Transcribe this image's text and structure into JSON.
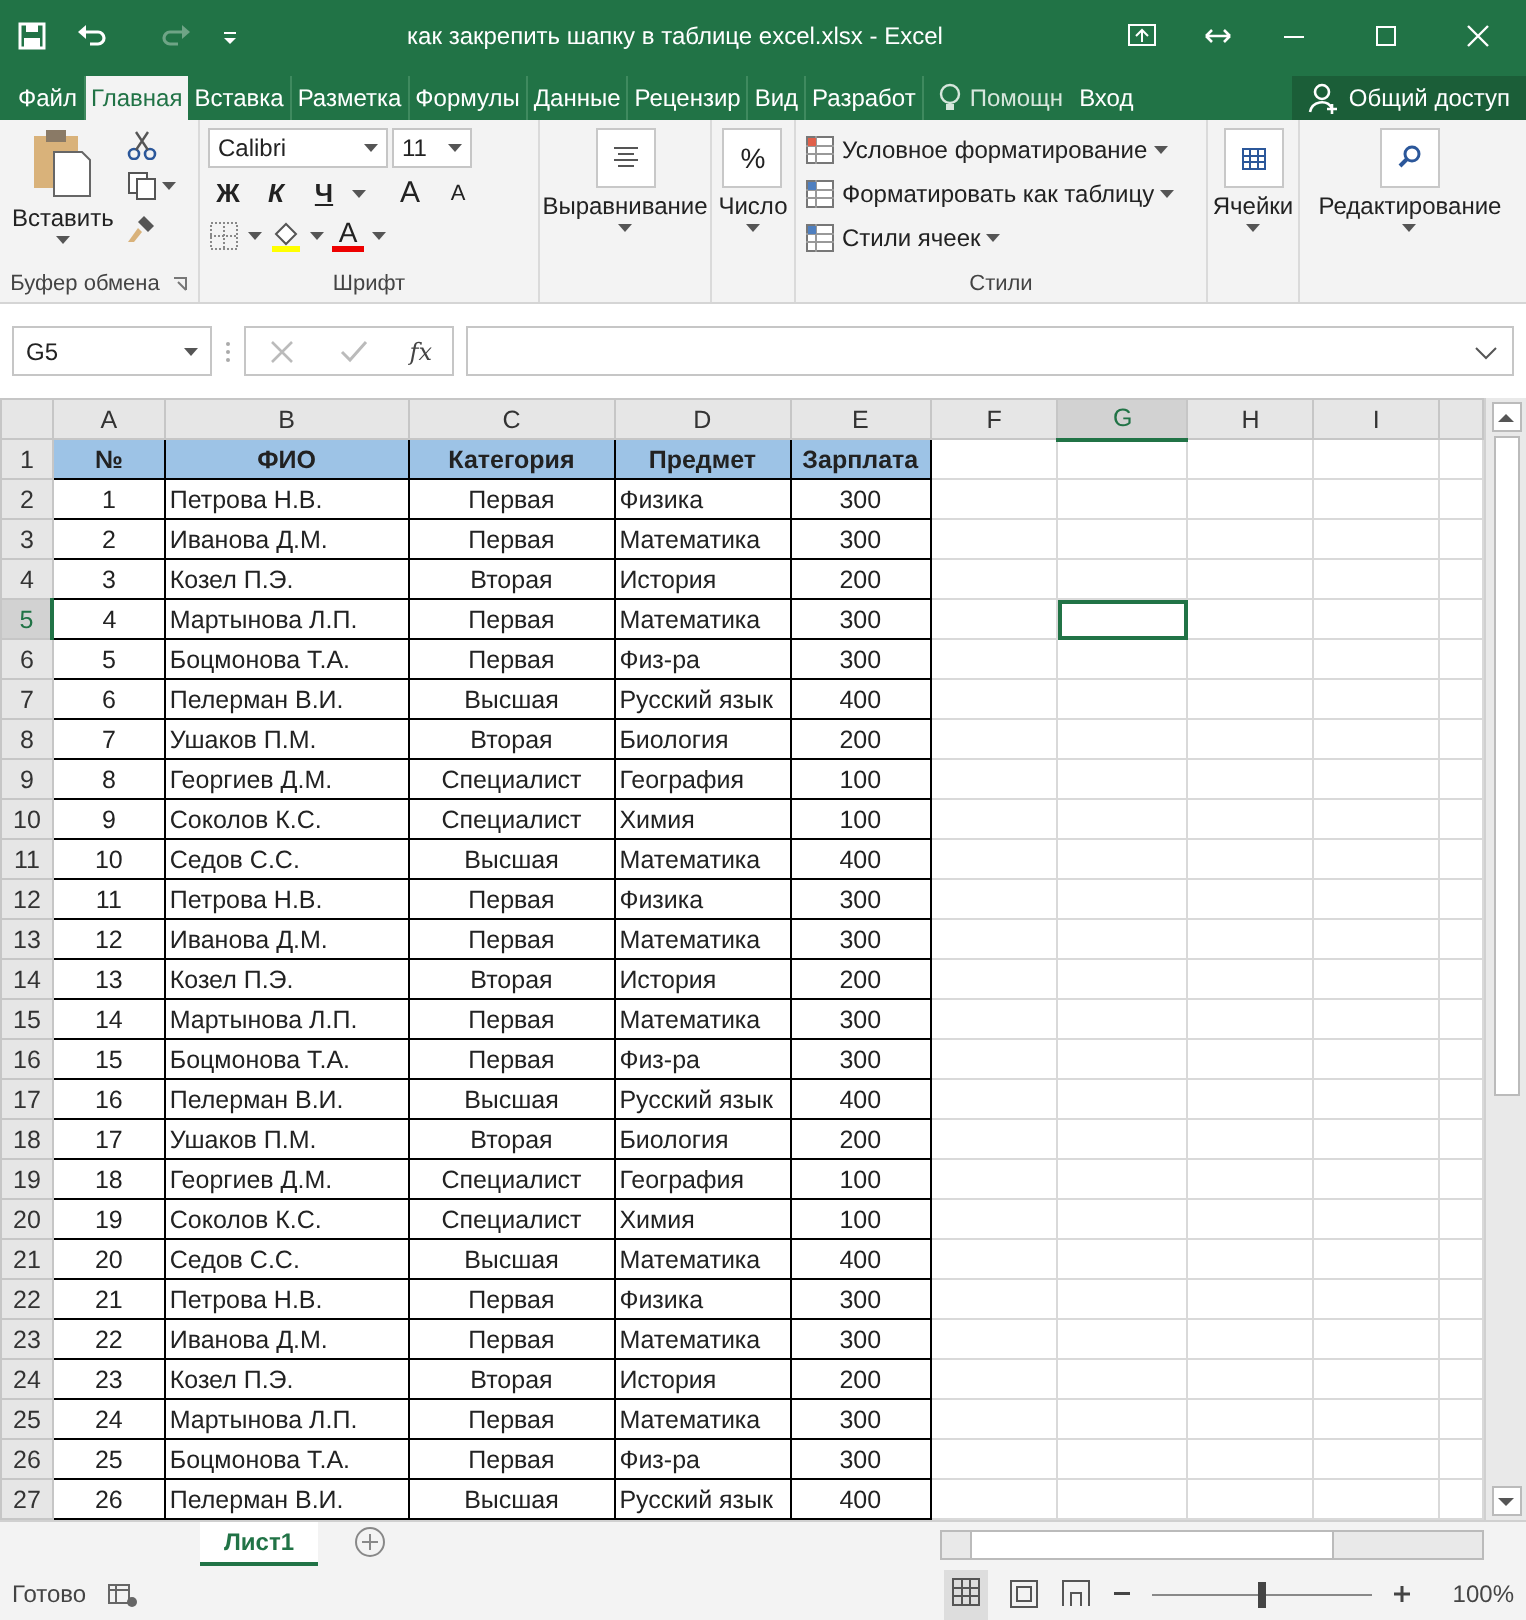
{
  "window": {
    "title": "как закрепить шапку в таблице excel.xlsx - Excel"
  },
  "ribbon_tabs": [
    {
      "label": "Файл",
      "selected": false
    },
    {
      "label": "Главная",
      "selected": true
    },
    {
      "label": "Вставка",
      "selected": false
    },
    {
      "label": "Разметка",
      "selected": false
    },
    {
      "label": "Формулы",
      "selected": false
    },
    {
      "label": "Данные",
      "selected": false
    },
    {
      "label": "Рецензир",
      "selected": false
    },
    {
      "label": "Вид",
      "selected": false
    },
    {
      "label": "Разработ",
      "selected": false
    }
  ],
  "help": "Помощн",
  "sign_in": "Вход",
  "share_button": "Общий доступ",
  "clipboard": {
    "paste": "Вставить",
    "label": "Буфер обмена"
  },
  "font": {
    "name": "Calibri",
    "size": "11",
    "bold": "Ж",
    "italic": "К",
    "underline": "Ч",
    "grow": "A",
    "shrink": "A",
    "font_color_letter": "A",
    "label": "Шрифт"
  },
  "alignment": {
    "label": "Выравнивание"
  },
  "number": {
    "symbol": "%",
    "label": "Число"
  },
  "styles": {
    "items": [
      "Условное форматирование",
      "Форматировать как таблицу",
      "Стили ячеек"
    ],
    "label": "Стили"
  },
  "cells": {
    "label": "Ячейки"
  },
  "editing": {
    "label": "Редактирование"
  },
  "name_box": "G5",
  "fx": "fx",
  "grid": {
    "columns": [
      {
        "label": "A",
        "selected": false
      },
      {
        "label": "B",
        "selected": false
      },
      {
        "label": "C",
        "selected": false
      },
      {
        "label": "D",
        "selected": false
      },
      {
        "label": "E",
        "selected": false
      },
      {
        "label": "F",
        "selected": false
      },
      {
        "label": "G",
        "selected": true
      },
      {
        "label": "H",
        "selected": false
      },
      {
        "label": "I",
        "selected": false
      }
    ],
    "rows": [
      {
        "label": "1",
        "selected": false,
        "kind": "header",
        "cells": [
          "№",
          "ФИО",
          "Категория",
          "Предмет",
          "Зарплата"
        ]
      },
      {
        "label": "2",
        "selected": false,
        "kind": "data",
        "cells": [
          "1",
          "Петрова Н.В.",
          "Первая",
          "Физика",
          "300"
        ]
      },
      {
        "label": "3",
        "selected": false,
        "kind": "data",
        "cells": [
          "2",
          "Иванова Д.М.",
          "Первая",
          "Математика",
          "300"
        ]
      },
      {
        "label": "4",
        "selected": false,
        "kind": "data",
        "cells": [
          "3",
          "Козел П.Э.",
          "Вторая",
          "История",
          "200"
        ]
      },
      {
        "label": "5",
        "selected": true,
        "kind": "data",
        "cells": [
          "4",
          "Мартынова Л.П.",
          "Первая",
          "Математика",
          "300"
        ]
      },
      {
        "label": "6",
        "selected": false,
        "kind": "data",
        "cells": [
          "5",
          "Боцмонова Т.А.",
          "Первая",
          "Физ-ра",
          "300"
        ]
      },
      {
        "label": "7",
        "selected": false,
        "kind": "data",
        "cells": [
          "6",
          "Пелерман В.И.",
          "Высшая",
          "Русский язык",
          "400"
        ]
      },
      {
        "label": "8",
        "selected": false,
        "kind": "data",
        "cells": [
          "7",
          "Ушаков П.М.",
          "Вторая",
          "Биология",
          "200"
        ]
      },
      {
        "label": "9",
        "selected": false,
        "kind": "data",
        "cells": [
          "8",
          "Георгиев Д.М.",
          "Специалист",
          "География",
          "100"
        ]
      },
      {
        "label": "10",
        "selected": false,
        "kind": "data",
        "cells": [
          "9",
          "Соколов К.С.",
          "Специалист",
          "Химия",
          "100"
        ]
      },
      {
        "label": "11",
        "selected": false,
        "kind": "data",
        "cells": [
          "10",
          "Седов С.С.",
          "Высшая",
          "Математика",
          "400"
        ]
      },
      {
        "label": "12",
        "selected": false,
        "kind": "data",
        "cells": [
          "11",
          "Петрова Н.В.",
          "Первая",
          "Физика",
          "300"
        ]
      },
      {
        "label": "13",
        "selected": false,
        "kind": "data",
        "cells": [
          "12",
          "Иванова Д.М.",
          "Первая",
          "Математика",
          "300"
        ]
      },
      {
        "label": "14",
        "selected": false,
        "kind": "data",
        "cells": [
          "13",
          "Козел П.Э.",
          "Вторая",
          "История",
          "200"
        ]
      },
      {
        "label": "15",
        "selected": false,
        "kind": "data",
        "cells": [
          "14",
          "Мартынова Л.П.",
          "Первая",
          "Математика",
          "300"
        ]
      },
      {
        "label": "16",
        "selected": false,
        "kind": "data",
        "cells": [
          "15",
          "Боцмонова Т.А.",
          "Первая",
          "Физ-ра",
          "300"
        ]
      },
      {
        "label": "17",
        "selected": false,
        "kind": "data",
        "cells": [
          "16",
          "Пелерман В.И.",
          "Высшая",
          "Русский язык",
          "400"
        ]
      },
      {
        "label": "18",
        "selected": false,
        "kind": "data",
        "cells": [
          "17",
          "Ушаков П.М.",
          "Вторая",
          "Биология",
          "200"
        ]
      },
      {
        "label": "19",
        "selected": false,
        "kind": "data",
        "cells": [
          "18",
          "Георгиев Д.М.",
          "Специалист",
          "География",
          "100"
        ]
      },
      {
        "label": "20",
        "selected": false,
        "kind": "data",
        "cells": [
          "19",
          "Соколов К.С.",
          "Специалист",
          "Химия",
          "100"
        ]
      },
      {
        "label": "21",
        "selected": false,
        "kind": "data",
        "cells": [
          "20",
          "Седов С.С.",
          "Высшая",
          "Математика",
          "400"
        ]
      },
      {
        "label": "22",
        "selected": false,
        "kind": "data",
        "cells": [
          "21",
          "Петрова Н.В.",
          "Первая",
          "Физика",
          "300"
        ]
      },
      {
        "label": "23",
        "selected": false,
        "kind": "data",
        "cells": [
          "22",
          "Иванова Д.М.",
          "Первая",
          "Математика",
          "300"
        ]
      },
      {
        "label": "24",
        "selected": false,
        "kind": "data",
        "cells": [
          "23",
          "Козел П.Э.",
          "Вторая",
          "История",
          "200"
        ]
      },
      {
        "label": "25",
        "selected": false,
        "kind": "data",
        "cells": [
          "24",
          "Мартынова Л.П.",
          "Первая",
          "Математика",
          "300"
        ]
      },
      {
        "label": "26",
        "selected": false,
        "kind": "data",
        "cells": [
          "25",
          "Боцмонова Т.А.",
          "Первая",
          "Физ-ра",
          "300"
        ]
      },
      {
        "label": "27",
        "selected": false,
        "kind": "data",
        "cells": [
          "26",
          "Пелерман В.И.",
          "Высшая",
          "Русский язык",
          "400"
        ]
      }
    ]
  },
  "sheet_tabs": [
    {
      "label": "Лист1",
      "selected": true
    }
  ],
  "status_bar": {
    "text": "Готово",
    "zoom": "100%"
  },
  "zoom_slider": {
    "level": 0.5
  }
}
